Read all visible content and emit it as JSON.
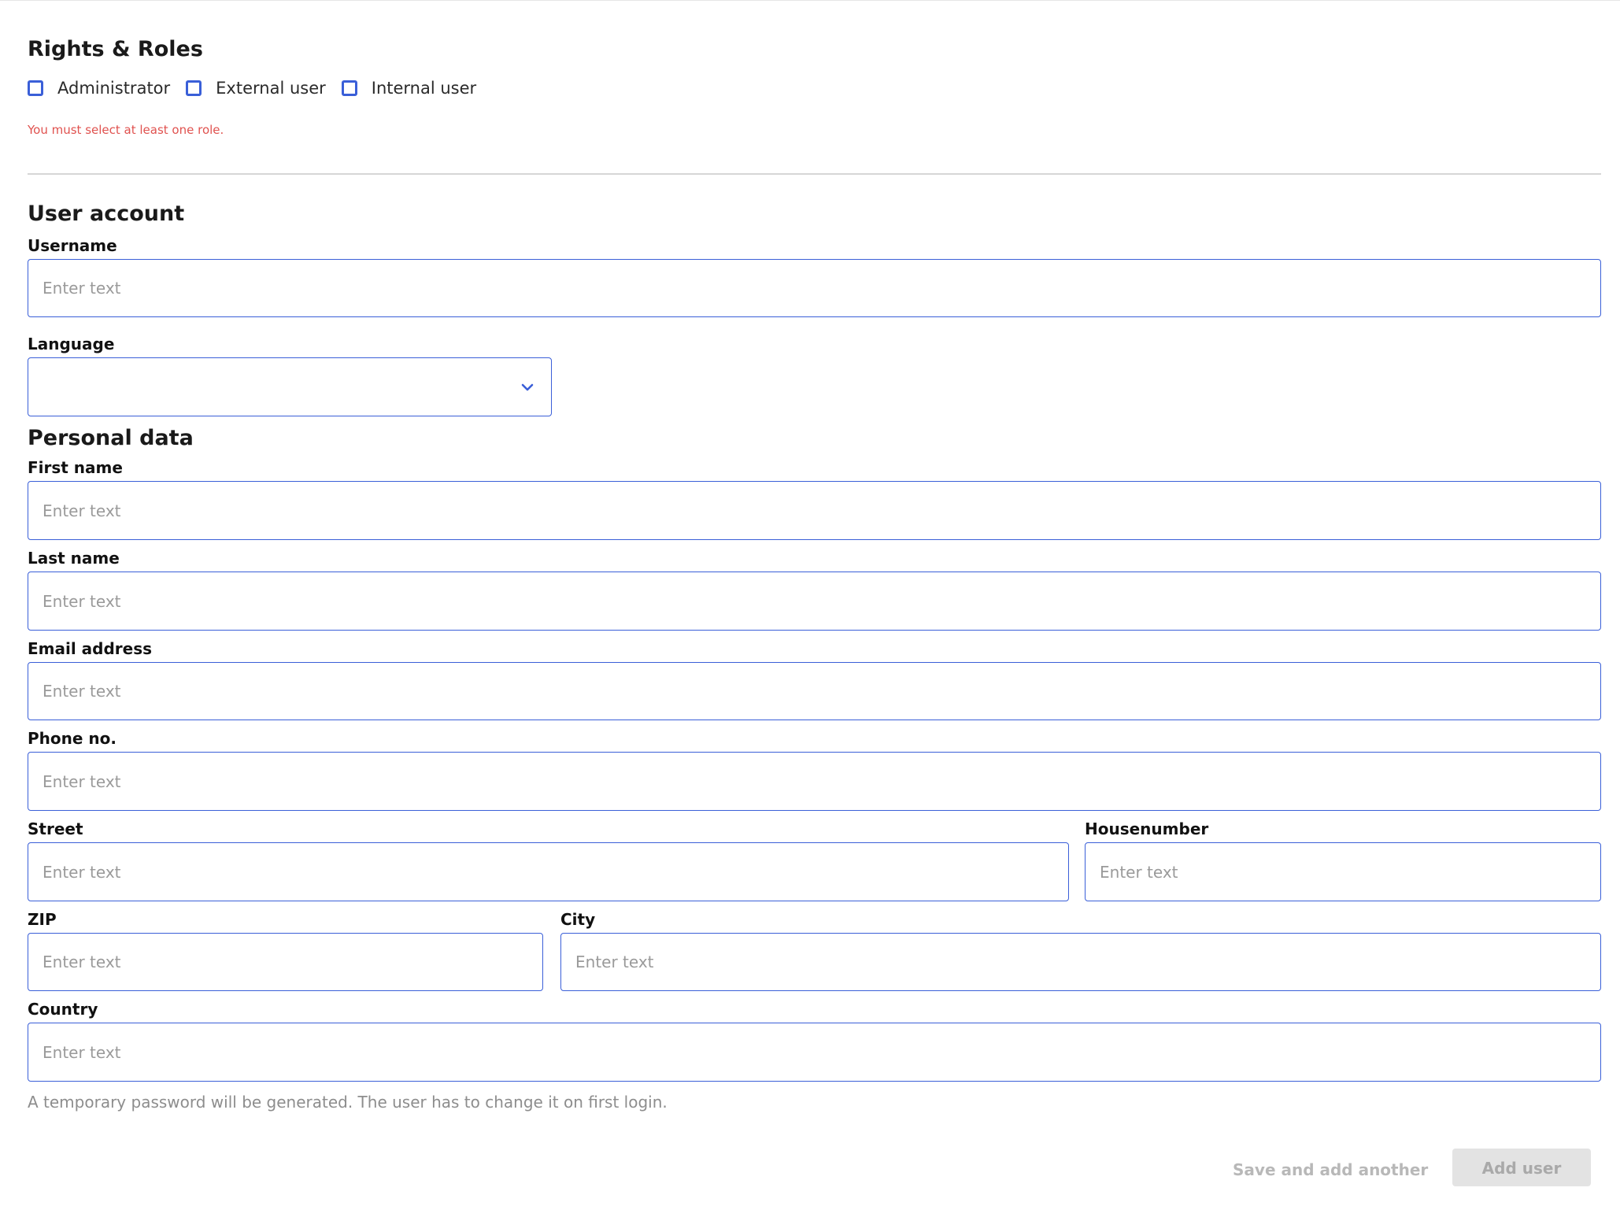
{
  "rights_roles": {
    "title": "Rights & Roles",
    "roles": [
      {
        "label": "Administrator",
        "checked": false
      },
      {
        "label": "External user",
        "checked": false
      },
      {
        "label": "Internal user",
        "checked": false
      }
    ],
    "error": "You must select at least one role."
  },
  "user_account": {
    "title": "User account",
    "username": {
      "label": "Username",
      "placeholder": "Enter text",
      "value": ""
    },
    "language": {
      "label": "Language",
      "value": ""
    }
  },
  "personal_data": {
    "title": "Personal data",
    "first_name": {
      "label": "First name",
      "placeholder": "Enter text",
      "value": ""
    },
    "last_name": {
      "label": "Last name",
      "placeholder": "Enter text",
      "value": ""
    },
    "email": {
      "label": "Email address",
      "placeholder": "Enter text",
      "value": ""
    },
    "phone": {
      "label": "Phone no.",
      "placeholder": "Enter text",
      "value": ""
    },
    "street": {
      "label": "Street",
      "placeholder": "Enter text",
      "value": ""
    },
    "housenumber": {
      "label": "Housenumber",
      "placeholder": "Enter text",
      "value": ""
    },
    "zip": {
      "label": "ZIP",
      "placeholder": "Enter text",
      "value": ""
    },
    "city": {
      "label": "City",
      "placeholder": "Enter text",
      "value": ""
    },
    "country": {
      "label": "Country",
      "placeholder": "Enter text",
      "value": ""
    }
  },
  "hint": "A temporary password will be generated. The user has to change it on first login.",
  "actions": {
    "save_and_add_another": "Save and add another",
    "add_user": "Add user"
  },
  "colors": {
    "accent": "#3a5fd8",
    "error": "#e0524f",
    "disabled_bg": "#e3e3e3",
    "disabled_text": "#a9a9a9"
  },
  "icons": {
    "language_dropdown": "chevron-down-icon"
  }
}
